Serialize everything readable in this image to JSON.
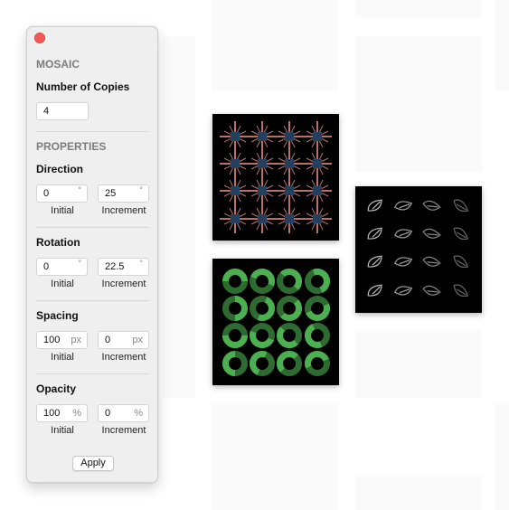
{
  "panel": {
    "mosaic_title": "MOSAIC",
    "copies_label": "Number of Copies",
    "copies_value": "4",
    "properties_title": "PROPERTIES",
    "groups": [
      {
        "label": "Direction",
        "initial": "0",
        "increment": "25",
        "unit": "°"
      },
      {
        "label": "Rotation",
        "initial": "0",
        "increment": "22.5",
        "unit": "°"
      },
      {
        "label": "Spacing",
        "initial": "100",
        "increment": "0",
        "unit": "px"
      },
      {
        "label": "Opacity",
        "initial": "100",
        "increment": "0",
        "unit": "%"
      }
    ],
    "initial_caption": "Initial",
    "increment_caption": "Increment",
    "apply_label": "Apply"
  },
  "canvases": [
    {
      "name": "arrows-mosaic",
      "grid": "4x4",
      "colors": {
        "line": "#b5716a",
        "center": "#24405e"
      }
    },
    {
      "name": "rings-mosaic",
      "grid": "4x4",
      "colors": {
        "light": "#4caf50",
        "dark": "#2e6b30"
      }
    },
    {
      "name": "leaves-mosaic",
      "grid": "4x4",
      "colors": {
        "stroke": "#bdbdbd"
      }
    }
  ]
}
